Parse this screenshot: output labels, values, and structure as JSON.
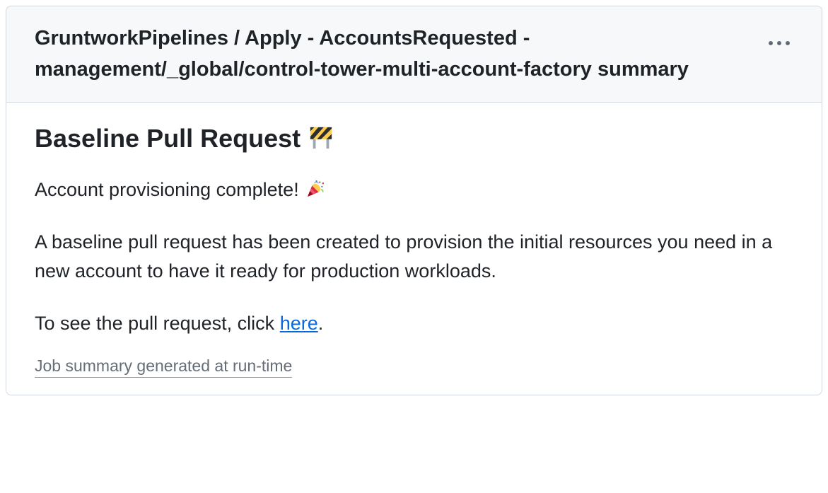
{
  "header": {
    "title": "GruntworkPipelines / Apply - AccountsRequested - management/_global/control-tower-multi-account-factory summary"
  },
  "body": {
    "heading": "Baseline Pull Request ",
    "line1": "Account provisioning complete! ",
    "line2": "A baseline pull request has been created to provision the initial resources you need in a new account to have it ready for production workloads.",
    "line3_prefix": "To see the pull request, click ",
    "line3_link": "here",
    "line3_suffix": "."
  },
  "footer": {
    "label": "Job summary generated at run-time"
  }
}
